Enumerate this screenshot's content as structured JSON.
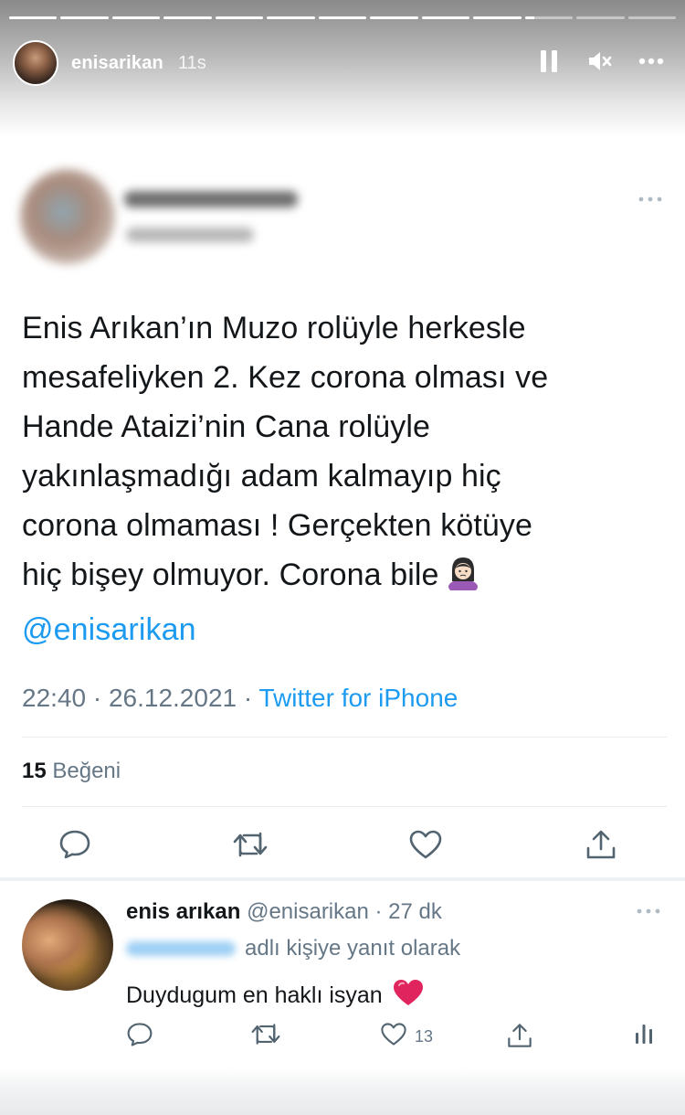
{
  "story": {
    "username": "enisarikan",
    "time_ago": "11s",
    "progress_segments": [
      1,
      1,
      1,
      1,
      1,
      1,
      1,
      1,
      1,
      1,
      0.2,
      0,
      0
    ]
  },
  "controls": {
    "pause_icon": "pause-icon",
    "mute_icon": "mute-icon",
    "more_icon": "more-horizontal-icon"
  },
  "tweet": {
    "lines": [
      "Enis Arıkan’ın Muzo rolüyle herkesle",
      "mesafeliyken 2. Kez corona olması ve",
      "Hande Ataizi’nin Cana rolüyle",
      "yakınlaşmadığı adam kalmayıp hiç",
      "corona olmaması ! Gerçekten kötüye",
      "hiç bişey olmuyor. Corona bile"
    ],
    "mention": "@enisarikan",
    "timestamp": "22:40 · 26.12.2021 · ",
    "source": "Twitter for iPhone",
    "likes_count": "15",
    "likes_label": "Beğeni"
  },
  "reply": {
    "name": "enis arıkan",
    "handle_time": "@enisarikan · 27 dk",
    "reply_to_text": "adlı kişiye yanıt olarak",
    "body": "Duydugum en haklı isyan",
    "like_count": "13"
  },
  "colors": {
    "accent": "#1d9bf0",
    "secondary_text": "#657786",
    "heart": "#e0245e"
  }
}
